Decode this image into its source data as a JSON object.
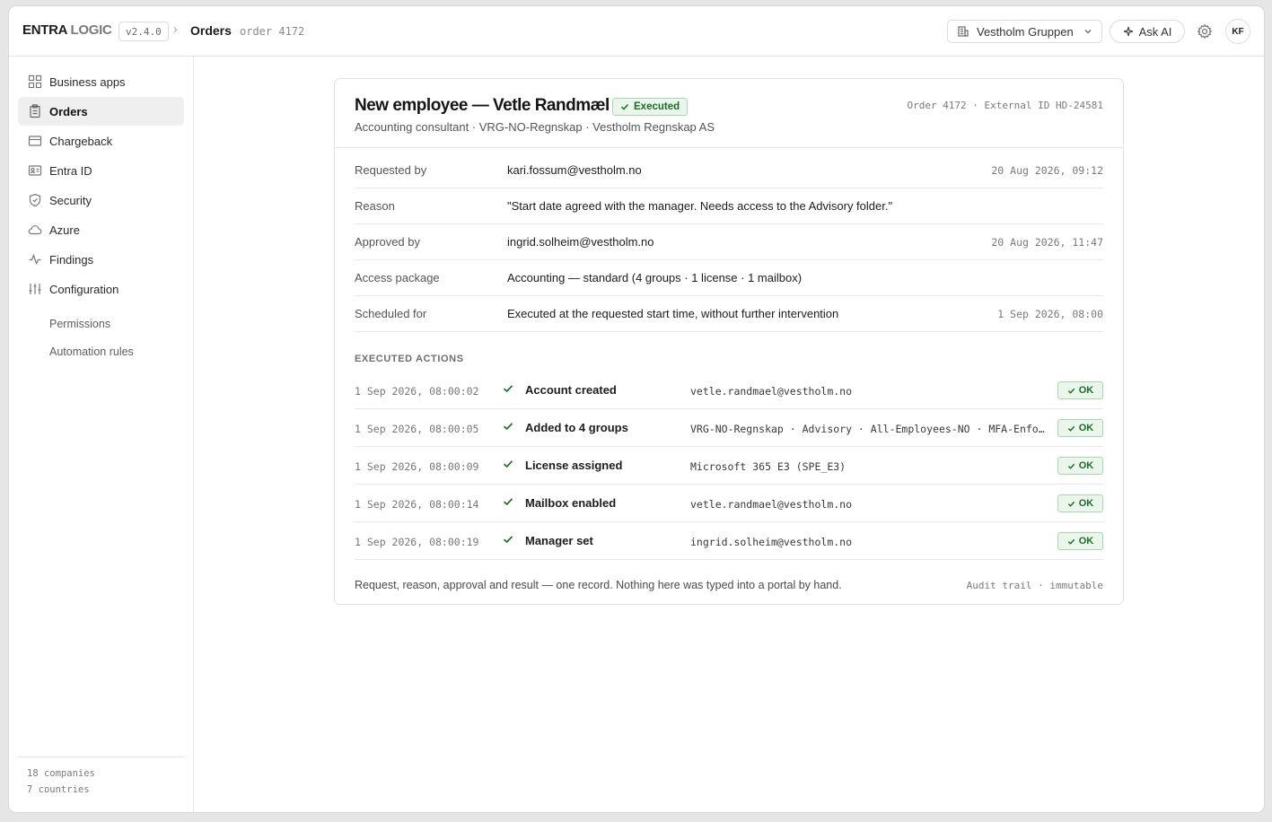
{
  "header": {
    "brand_part1": "ENTRA",
    "brand_part2": "LOGIC",
    "version": "v2.4.0",
    "breadcrumb_separator": "›",
    "page": "Orders",
    "sub": "order 4172",
    "tenant": "Vestholm Gruppen",
    "ask_ai": "Ask AI",
    "avatar": "KF"
  },
  "sidebar": {
    "items": [
      {
        "label": "Business apps",
        "icon": "grid-icon"
      },
      {
        "label": "Orders",
        "icon": "clipboard-icon",
        "active": true
      },
      {
        "label": "Chargeback",
        "icon": "credit-card-icon"
      },
      {
        "label": "Entra ID",
        "icon": "id-card-icon"
      },
      {
        "label": "Security",
        "icon": "shield-icon"
      },
      {
        "label": "Azure",
        "icon": "cloud-icon"
      },
      {
        "label": "Findings",
        "icon": "activity-icon"
      },
      {
        "label": "Configuration",
        "icon": "sliders-icon"
      }
    ],
    "subitems": [
      {
        "label": "Permissions"
      },
      {
        "label": "Automation rules"
      }
    ],
    "footer": {
      "companies": "18 companies",
      "countries": "7 countries"
    }
  },
  "order": {
    "title": "New employee — Vetle Randmæl",
    "status": "Executed",
    "meta": "Order 4172 · External ID HD-24581",
    "subtitle": "Accounting consultant · VRG-NO-Regnskap · Vestholm Regnskap AS",
    "fields": [
      {
        "label": "Requested by",
        "value": "kari.fossum@vestholm.no",
        "time": "20 Aug 2026, 09:12"
      },
      {
        "label": "Reason",
        "value": "\"Start date agreed with the manager. Needs access to the Advisory folder.\"",
        "time": ""
      },
      {
        "label": "Approved by",
        "value": "ingrid.solheim@vestholm.no",
        "time": "20 Aug 2026, 11:47"
      },
      {
        "label": "Access package",
        "value": "Accounting — standard (4 groups · 1 license · 1 mailbox)",
        "time": ""
      },
      {
        "label": "Scheduled for",
        "value": "Executed at the requested start time, without further intervention",
        "time": "1 Sep 2026, 08:00"
      }
    ],
    "actions_heading": "EXECUTED ACTIONS",
    "actions": [
      {
        "time": "1 Sep 2026, 08:00:02",
        "action": "Account created",
        "detail": "vetle.randmael@vestholm.no",
        "status": "OK"
      },
      {
        "time": "1 Sep 2026, 08:00:05",
        "action": "Added to 4 groups",
        "detail": "VRG-NO-Regnskap · Advisory · All-Employees-NO · MFA-Enforced",
        "status": "OK"
      },
      {
        "time": "1 Sep 2026, 08:00:09",
        "action": "License assigned",
        "detail": "Microsoft 365 E3 (SPE_E3)",
        "status": "OK"
      },
      {
        "time": "1 Sep 2026, 08:00:14",
        "action": "Mailbox enabled",
        "detail": "vetle.randmael@vestholm.no",
        "status": "OK"
      },
      {
        "time": "1 Sep 2026, 08:00:19",
        "action": "Manager set",
        "detail": "ingrid.solheim@vestholm.no",
        "status": "OK"
      }
    ],
    "footer_note": "Request, reason, approval and result — one record. Nothing here was typed into a portal by hand.",
    "footer_audit": "Audit trail · immutable"
  },
  "colors": {
    "success": "#1e6b29",
    "success_bg": "#eaf6eb",
    "active_nav": "#efefef"
  }
}
